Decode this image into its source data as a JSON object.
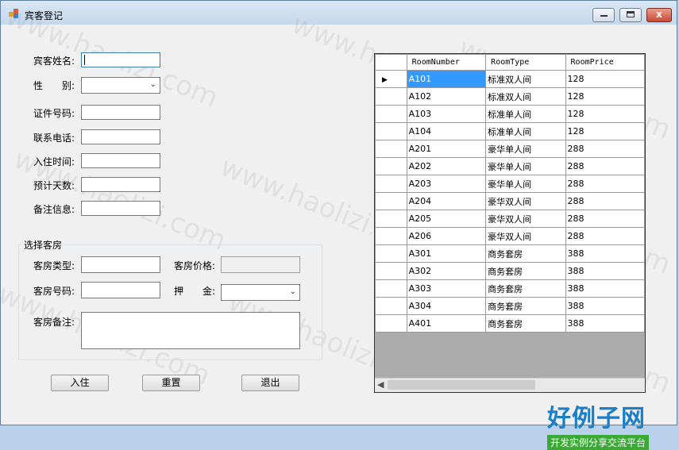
{
  "window": {
    "title": "宾客登记",
    "close_glyph": "x",
    "maximize_glyph": "□",
    "minimize_glyph": "_"
  },
  "form": {
    "guest_name_label": "宾客姓名:",
    "gender_label_a": "性",
    "gender_label_b": "别:",
    "id_number_label": "证件号码:",
    "phone_label": "联系电话:",
    "checkin_time_label": "入住时间:",
    "days_label": "预计天数:",
    "remark_label": "备注信息:"
  },
  "room_group": {
    "title": "选择客房",
    "room_type_label": "客房类型:",
    "room_price_label": "客房价格:",
    "room_number_label": "客房号码:",
    "deposit_label_a": "押",
    "deposit_label_b": "金:",
    "room_remark_label": "客房备注:"
  },
  "buttons": {
    "checkin": "入住",
    "reset": "重置",
    "exit": "退出"
  },
  "grid": {
    "columns": [
      "RoomNumber",
      "RoomType",
      "RoomPrice"
    ],
    "rows": [
      [
        "A101",
        "标准双人间",
        "128"
      ],
      [
        "A102",
        "标准双人间",
        "128"
      ],
      [
        "A103",
        "标准单人间",
        "128"
      ],
      [
        "A104",
        "标准单人间",
        "128"
      ],
      [
        "A201",
        "豪华单人间",
        "288"
      ],
      [
        "A202",
        "豪华单人间",
        "288"
      ],
      [
        "A203",
        "豪华单人间",
        "288"
      ],
      [
        "A204",
        "豪华双人间",
        "288"
      ],
      [
        "A205",
        "豪华双人间",
        "288"
      ],
      [
        "A206",
        "豪华双人间",
        "288"
      ],
      [
        "A301",
        "商务套房",
        "388"
      ],
      [
        "A302",
        "商务套房",
        "388"
      ],
      [
        "A303",
        "商务套房",
        "388"
      ],
      [
        "A304",
        "商务套房",
        "388"
      ],
      [
        "A401",
        "商务套房",
        "388"
      ]
    ],
    "selected_row": 0
  },
  "watermark": {
    "text": "www.haolizi.com"
  },
  "logo": {
    "main": "好例子网",
    "sub": "开发实例分享交流平台"
  },
  "colors": {
    "selection": "#3399ff",
    "logo_blue": "#1a7ec8",
    "logo_green": "#3aaa35"
  }
}
